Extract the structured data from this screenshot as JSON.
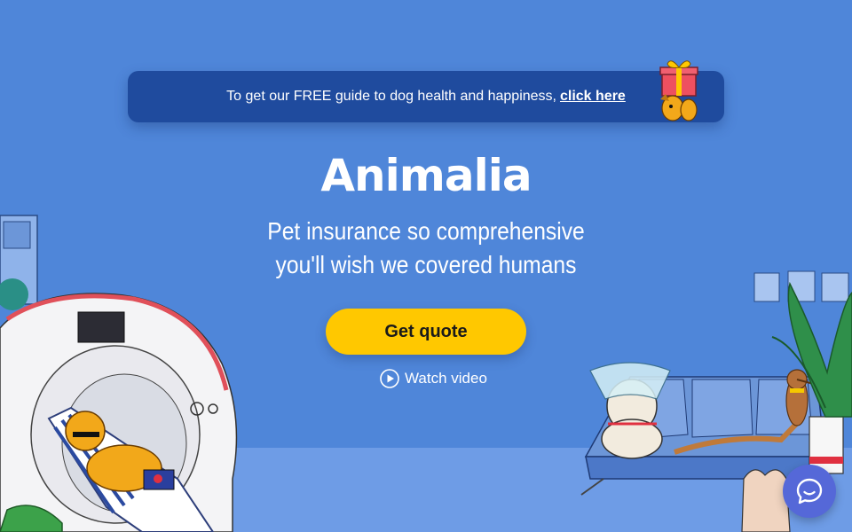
{
  "banner": {
    "text": "To get our FREE guide to dog health and happiness,",
    "link": "click here",
    "icon": "gift-icon"
  },
  "brand": {
    "logo_text": "Animalia"
  },
  "hero": {
    "tagline_line1": "Pet insurance so comprehensive",
    "tagline_line2": "you'll wish we covered humans",
    "cta_label": "Get quote",
    "video_label": "Watch video",
    "video_icon": "play-circle-icon"
  },
  "chat": {
    "icon": "chat-bubble-icon"
  },
  "colors": {
    "background": "#4f86d9",
    "banner": "#1f4b9e",
    "cta": "#ffc800",
    "chat": "#5568d8"
  }
}
